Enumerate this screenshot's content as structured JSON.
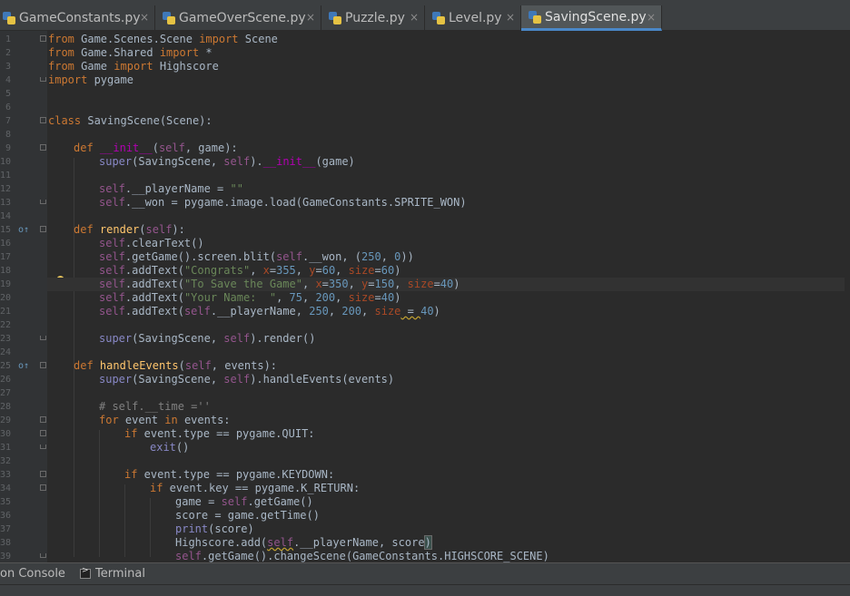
{
  "tabs": [
    {
      "label": "GameConstants.py",
      "active": false
    },
    {
      "label": "GameOverScene.py",
      "active": false
    },
    {
      "label": "Puzzle.py",
      "active": false
    },
    {
      "label": "Level.py",
      "active": false
    },
    {
      "label": "SavingScene.py",
      "active": true
    }
  ],
  "close_glyph": "×",
  "line_numbers": [
    "1",
    "2",
    "3",
    "4",
    "5",
    "6",
    "7",
    "8",
    "9",
    "10",
    "11",
    "12",
    "13",
    "14",
    "15",
    "16",
    "17",
    "18",
    "19",
    "20",
    "21",
    "22",
    "23",
    "24",
    "25",
    "26",
    "27",
    "28",
    "29",
    "30",
    "31",
    "32",
    "33",
    "34",
    "35",
    "36",
    "37",
    "38",
    "39"
  ],
  "gutter": {
    "override_marker": "o↑",
    "override_lines": [
      15,
      25
    ],
    "bulb_line": 19
  },
  "code": {
    "l1": {
      "p1": "from",
      "p2": " Game.Scenes.Scene ",
      "p3": "import",
      "p4": " Scene"
    },
    "l2": {
      "p1": "from",
      "p2": " Game.Shared ",
      "p3": "import",
      "p4": " *"
    },
    "l3": {
      "p1": "from",
      "p2": " Game ",
      "p3": "import",
      "p4": " Highscore"
    },
    "l4": {
      "p1": "import",
      "p2": " pygame"
    },
    "l7": {
      "p1": "class",
      "p2": " SavingScene(Scene):"
    },
    "l9": {
      "p1": "def",
      "p2": " ",
      "p3": "__init__",
      "p4": "(",
      "p5": "self",
      "p6": ", game):"
    },
    "l10": {
      "p1": "super",
      "p2": "(SavingScene, ",
      "p3": "self",
      "p4": ").",
      "p5": "__init__",
      "p6": "(game)"
    },
    "l12": {
      "p1": "self",
      "p2": ".__playerName = ",
      "p3": "\"\""
    },
    "l13": {
      "p1": "self",
      "p2": ".__won = pygame.image.load(GameConstants.SPRITE_WON)"
    },
    "l15": {
      "p1": "def",
      "p2": " ",
      "p3": "render",
      "p4": "(",
      "p5": "self",
      "p6": "):"
    },
    "l16": {
      "p1": "self",
      "p2": ".clearText()"
    },
    "l17": {
      "p1": "self",
      "p2": ".getGame().screen.blit(",
      "p3": "self",
      "p4": ".__won, (",
      "p5": "250",
      "p6": ", ",
      "p7": "0",
      "p8": "))"
    },
    "l18": {
      "p1": "self",
      "p2": ".addText(",
      "p3": "\"Congrats\"",
      "p4": ", ",
      "p5": "x",
      "p6": "=",
      "p7": "355",
      "p8": ", ",
      "p9": "y",
      "p10": "=",
      "p11": "60",
      "p12": ", ",
      "p13": "size",
      "p14": "=",
      "p15": "60",
      "p16": ")"
    },
    "l19": {
      "p1": "self",
      "p2": ".addText(",
      "p3": "\"To Save the Game\"",
      "p4": ", ",
      "p5": "x",
      "p6": "=",
      "p7": "350",
      "p8": ", ",
      "p9": "y",
      "p10": "=",
      "p11": "150",
      "p12": ", ",
      "p13": "size",
      "p14": "=",
      "p15": "40",
      "p16": ")"
    },
    "l20": {
      "p1": "self",
      "p2": ".addText(",
      "p3": "\"Your Name:  \"",
      "p4": ", ",
      "p5": "75",
      "p6": ", ",
      "p7": "200",
      "p8": ", ",
      "p9": "size",
      "p10": "=",
      "p11": "40",
      "p12": ")"
    },
    "l21": {
      "p1": "self",
      "p2": ".addText(",
      "p3": "self",
      "p4": ".__playerName, ",
      "p5": "250",
      "p6": ", ",
      "p7": "200",
      "p8": ", ",
      "p9": "size",
      "p10": " = ",
      "p11": "40",
      "p12": ")"
    },
    "l23": {
      "p1": "super",
      "p2": "(SavingScene, ",
      "p3": "self",
      "p4": ").render()"
    },
    "l25": {
      "p1": "def",
      "p2": " ",
      "p3": "handleEvents",
      "p4": "(",
      "p5": "self",
      "p6": ", events):"
    },
    "l26": {
      "p1": "super",
      "p2": "(SavingScene, ",
      "p3": "self",
      "p4": ").handleEvents(events)"
    },
    "l28": {
      "p1": "# self.__time =''"
    },
    "l29": {
      "p1": "for",
      "p2": " event ",
      "p3": "in",
      "p4": " events:"
    },
    "l30": {
      "p1": "if",
      "p2": " event.type == pygame.QUIT:"
    },
    "l31": {
      "p1": "exit",
      "p2": "()"
    },
    "l33": {
      "p1": "if",
      "p2": " event.type == pygame.KEYDOWN:"
    },
    "l34": {
      "p1": "if",
      "p2": " event.key == pygame.K_RETURN:"
    },
    "l35": {
      "p1": "game = ",
      "p2": "self",
      "p3": ".getGame()"
    },
    "l36": {
      "p1": "score = game.getTime()"
    },
    "l37": {
      "p1": "print",
      "p2": "(score)"
    },
    "l38": {
      "p1": "Highscore.add(",
      "p2": "self",
      "p3": ".__playerName, score",
      "p4": ")"
    },
    "l39": {
      "p1": "self",
      "p2": ".getGame().changeScene(GameConstants.HIGHSCORE_SCENE)"
    }
  },
  "bottom_tabs": {
    "console": "on Console",
    "terminal": "Terminal"
  },
  "colors": {
    "keyword": "#cc7832",
    "self": "#94558d",
    "string": "#6a8759",
    "number": "#6897bb",
    "dunder": "#b200b2",
    "function": "#ffc66d",
    "comment": "#808080",
    "param": "#aa4926",
    "builtin": "#8888c6",
    "active_tab_underline": "#4a88c7"
  }
}
